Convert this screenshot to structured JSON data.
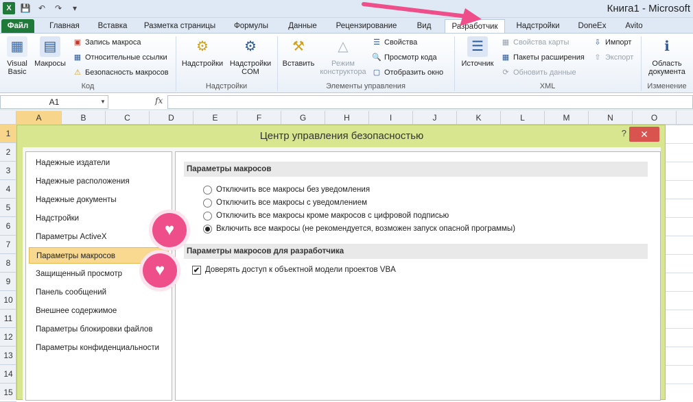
{
  "window": {
    "title": "Книга1 - Microsoft"
  },
  "qat": {
    "icons": [
      "excel-icon",
      "save-icon",
      "undo-icon",
      "redo-icon",
      "customize-icon"
    ]
  },
  "tabs": [
    "Файл",
    "Главная",
    "Вставка",
    "Разметка страницы",
    "Формулы",
    "Данные",
    "Рецензирование",
    "Вид",
    "Разработчик",
    "Надстройки",
    "DoneEx",
    "Avito"
  ],
  "active_tab": "Разработчик",
  "ribbon": {
    "code": {
      "label": "Код",
      "visual_basic": "Visual Basic",
      "macros": "Макросы",
      "record_macro": "Запись макроса",
      "relative_refs": "Относительные ссылки",
      "macro_security": "Безопасность макросов"
    },
    "addins": {
      "label": "Надстройки",
      "addins": "Надстройки",
      "com_addins": "Надстройки COM"
    },
    "controls": {
      "label": "Элементы управления",
      "insert": "Вставить",
      "design_mode": "Режим конструктора",
      "properties": "Свойства",
      "view_code": "Просмотр кода",
      "show_window": "Отобразить окно"
    },
    "xml": {
      "label": "XML",
      "source": "Источник",
      "map_properties": "Свойства карты",
      "expansion_packs": "Пакеты расширения",
      "refresh_data": "Обновить данные",
      "import": "Импорт",
      "export": "Экспорт"
    },
    "modify": {
      "label": "Изменение",
      "document_panel": "Область документа"
    }
  },
  "formula_bar": {
    "name_box": "A1",
    "fx": "fx",
    "value": ""
  },
  "columns": [
    "A",
    "B",
    "C",
    "D",
    "E",
    "F",
    "G",
    "H",
    "I",
    "J",
    "K",
    "L",
    "M",
    "N",
    "O"
  ],
  "rows": [
    "1",
    "2",
    "3",
    "4",
    "5",
    "6",
    "7",
    "8",
    "9",
    "10",
    "11",
    "12",
    "13",
    "14",
    "15"
  ],
  "dialog": {
    "title": "Центр управления безопасностью",
    "help": "?",
    "close": "✕",
    "nav": [
      "Надежные издатели",
      "Надежные расположения",
      "Надежные документы",
      "Надстройки",
      "Параметры ActiveX",
      "Параметры макросов",
      "Защищенный просмотр",
      "Панель сообщений",
      "Внешнее содержимое",
      "Параметры блокировки файлов",
      "Параметры конфиденциальности"
    ],
    "selected_nav": "Параметры макросов",
    "macro_section": "Параметры макросов",
    "macro_options": [
      "Отключить все макросы без уведомления",
      "Отключить все макросы с уведомлением",
      "Отключить все макросы кроме макросов с цифровой подписью",
      "Включить все макросы (не рекомендуется, возможен запуск опасной программы)"
    ],
    "selected_option": "Включить все макросы (не рекомендуется, возможен запуск опасной программы)",
    "dev_section": "Параметры макросов для разработчика",
    "vba_trust": {
      "label": "Доверять доступ к объектной модели проектов VBA",
      "checked": true
    }
  },
  "colors": {
    "accent_pink": "#ee4f8b",
    "dialog_bg": "#d7e68f",
    "selection": "#f8d98f",
    "file_tab": "#1f7a3a"
  }
}
